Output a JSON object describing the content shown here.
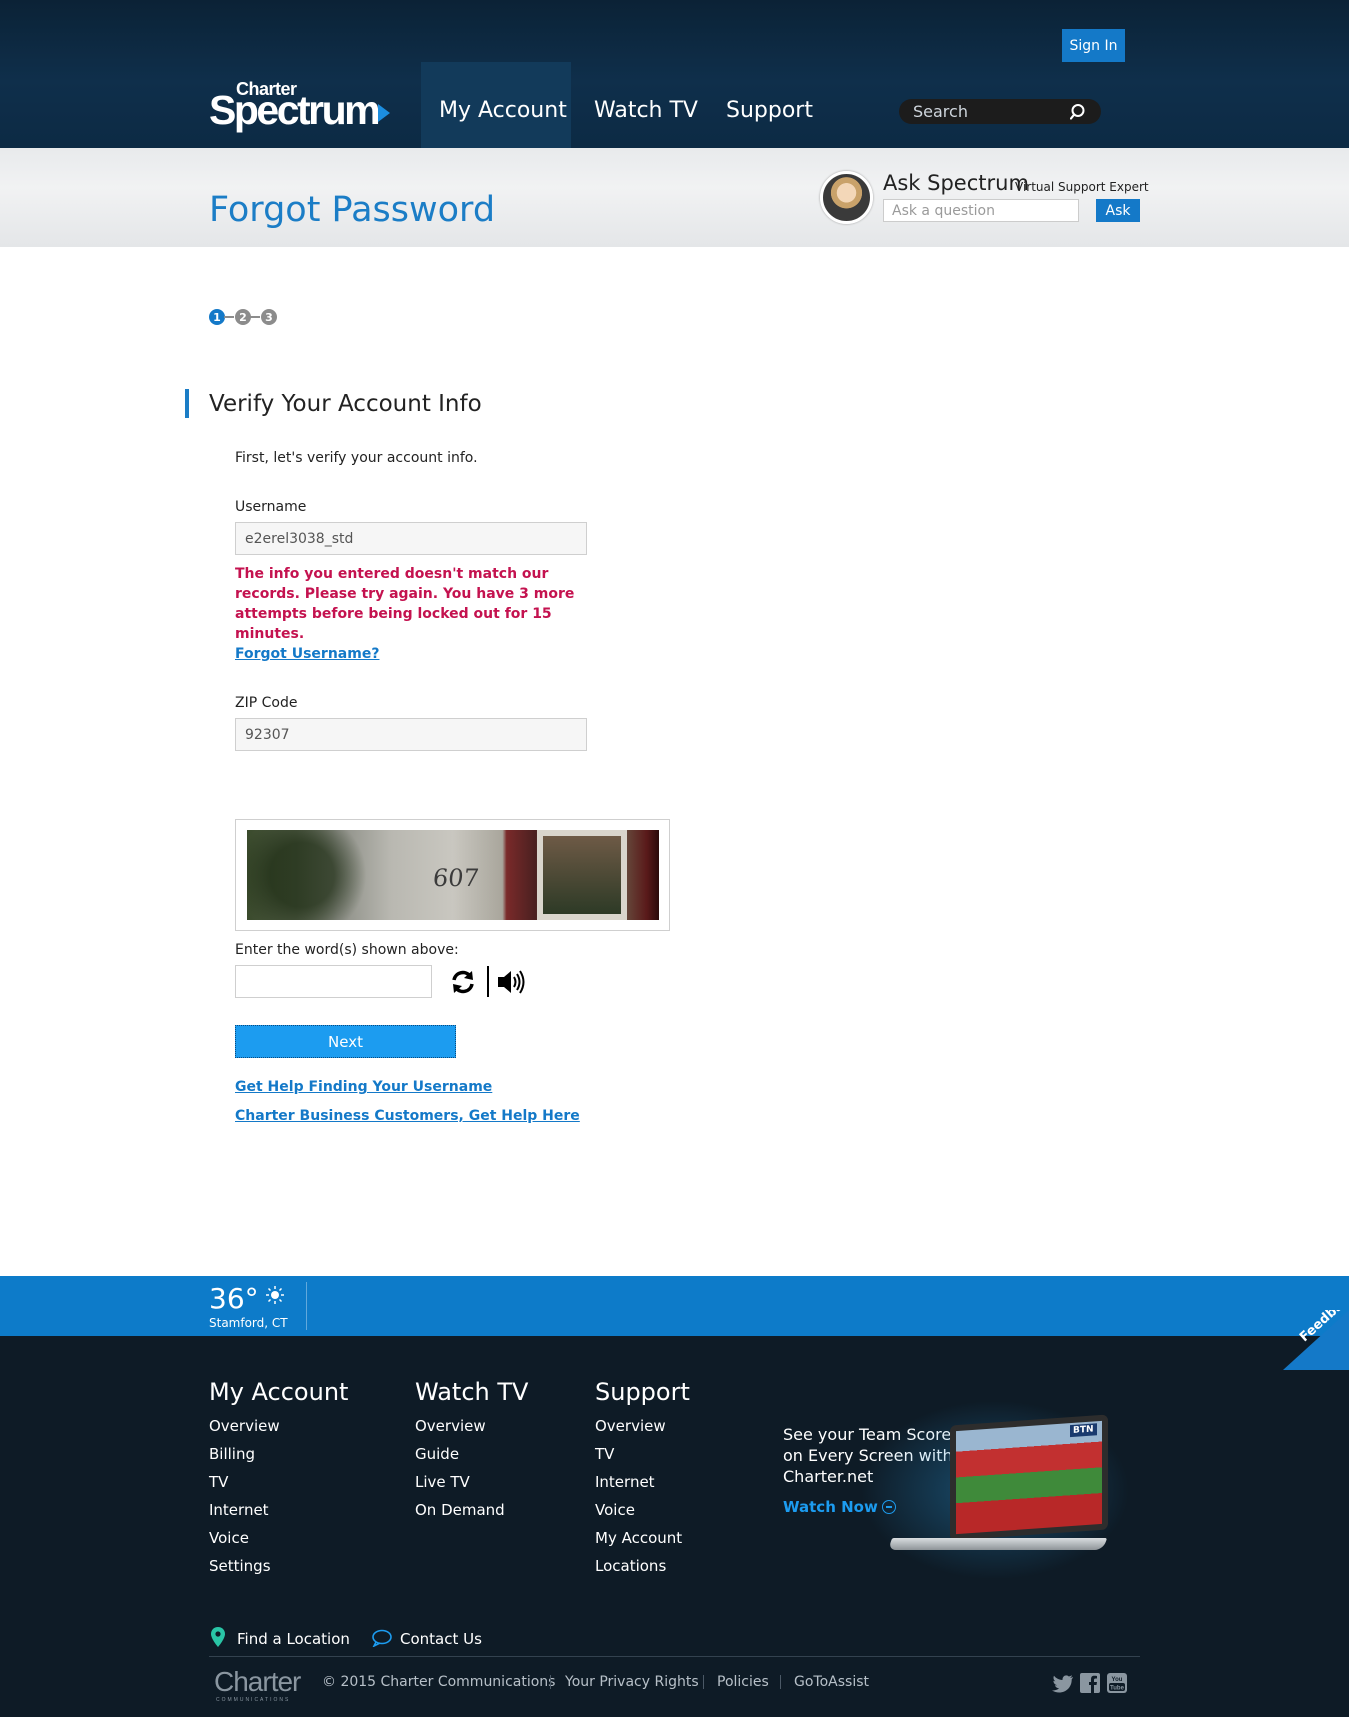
{
  "header": {
    "sign_in": "Sign In",
    "logo": {
      "top": "Charter",
      "main": "Spectrum"
    },
    "nav": [
      "My Account",
      "Watch TV",
      "Support"
    ],
    "search_placeholder": "Search"
  },
  "title_band": {
    "title": "Forgot Password",
    "ask_title": "Ask Spectrum",
    "ask_subtitle": "Virtual Support Expert",
    "ask_placeholder": "Ask a question",
    "ask_button": "Ask"
  },
  "steps": {
    "labels": [
      "1",
      "2",
      "3"
    ],
    "active": 1
  },
  "form": {
    "section_title": "Verify Your Account Info",
    "intro": "First, let's verify your account info.",
    "username_label": "Username",
    "username_value": "e2erel3038_std",
    "error": "The info you entered doesn't match our records. Please try again. You have 3 more attempts before being locked out for 15 minutes.",
    "forgot_username": "Forgot Username?",
    "zip_label": "ZIP Code",
    "zip_value": "92307",
    "captcha_text": "607",
    "captcha_label": "Enter the word(s) shown above:",
    "next_button": "Next",
    "help_username": "Get Help Finding Your Username",
    "business_help": "Charter Business Customers, Get Help Here"
  },
  "weather": {
    "temperature": "36°",
    "city": "Stamford, CT"
  },
  "feedback": "Feedback",
  "footer": {
    "columns": [
      {
        "title": "My Account",
        "links": [
          "Overview",
          "Billing",
          "TV",
          "Internet",
          "Voice",
          "Settings"
        ]
      },
      {
        "title": "Watch TV",
        "links": [
          "Overview",
          "Guide",
          "Live TV",
          "On Demand"
        ]
      },
      {
        "title": "Support",
        "links": [
          "Overview",
          "TV",
          "Internet",
          "Voice",
          "My Account",
          "Locations"
        ]
      }
    ],
    "promo": {
      "text": "See your Team Score on Every Screen with Charter.net",
      "cta": "Watch Now",
      "badge": "BTN"
    },
    "find_location": "Find a Location",
    "contact_us": "Contact Us",
    "charter_logo": {
      "main": "Charter",
      "sub": "COMMUNICATIONS"
    },
    "legal": [
      "© 2015 Charter Communications",
      "Your Privacy Rights",
      "Policies",
      "GoToAssist"
    ],
    "social": [
      "twitter-icon",
      "facebook-icon",
      "youtube-icon"
    ]
  },
  "colors": {
    "brand_blue": "#1479c8",
    "header_bg": "#0f2f4b",
    "error_red": "#c4124f",
    "footer_bg": "#0e1b26"
  }
}
